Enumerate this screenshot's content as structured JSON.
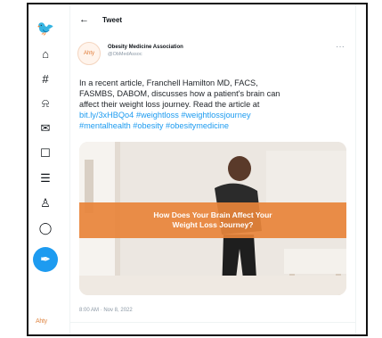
{
  "nav": {
    "items": [
      {
        "name": "twitter-logo-icon",
        "glyph": "🐦"
      },
      {
        "name": "home-icon",
        "glyph": "⌂"
      },
      {
        "name": "explore-icon",
        "glyph": "#"
      },
      {
        "name": "notifications-icon",
        "glyph": "⍾"
      },
      {
        "name": "messages-icon",
        "glyph": "✉"
      },
      {
        "name": "bookmarks-icon",
        "glyph": "☐"
      },
      {
        "name": "lists-icon",
        "glyph": "☰"
      },
      {
        "name": "profile-icon",
        "glyph": "♙"
      },
      {
        "name": "more-icon",
        "glyph": "◯"
      }
    ],
    "compose_glyph": "✒",
    "account_label": "Ahty"
  },
  "header": {
    "back_glyph": "←",
    "title": "Tweet"
  },
  "tweet": {
    "avatar_text": "Ahty",
    "display_name": "Obesity Medicine Association",
    "handle": "@ObMedAssoc",
    "more_glyph": "···",
    "text_line1": "In a recent article, Franchell Hamilton MD, FACS,",
    "text_line2": "FASMBS, DABOM, discusses how a patient's brain can",
    "text_line3": "affect their weight loss journey. Read the article at",
    "link": "bit.ly/3xHBQo4",
    "tags_line1": "#weightloss #weightlossjourney",
    "tags_line2": "#mentalhealth #obesity #obesitymedicine",
    "media_caption_line1": "How Does Your Brain Affect Your",
    "media_caption_line2": "Weight Loss Journey?",
    "timestamp": "8:00 AM · Nov 8, 2022"
  }
}
